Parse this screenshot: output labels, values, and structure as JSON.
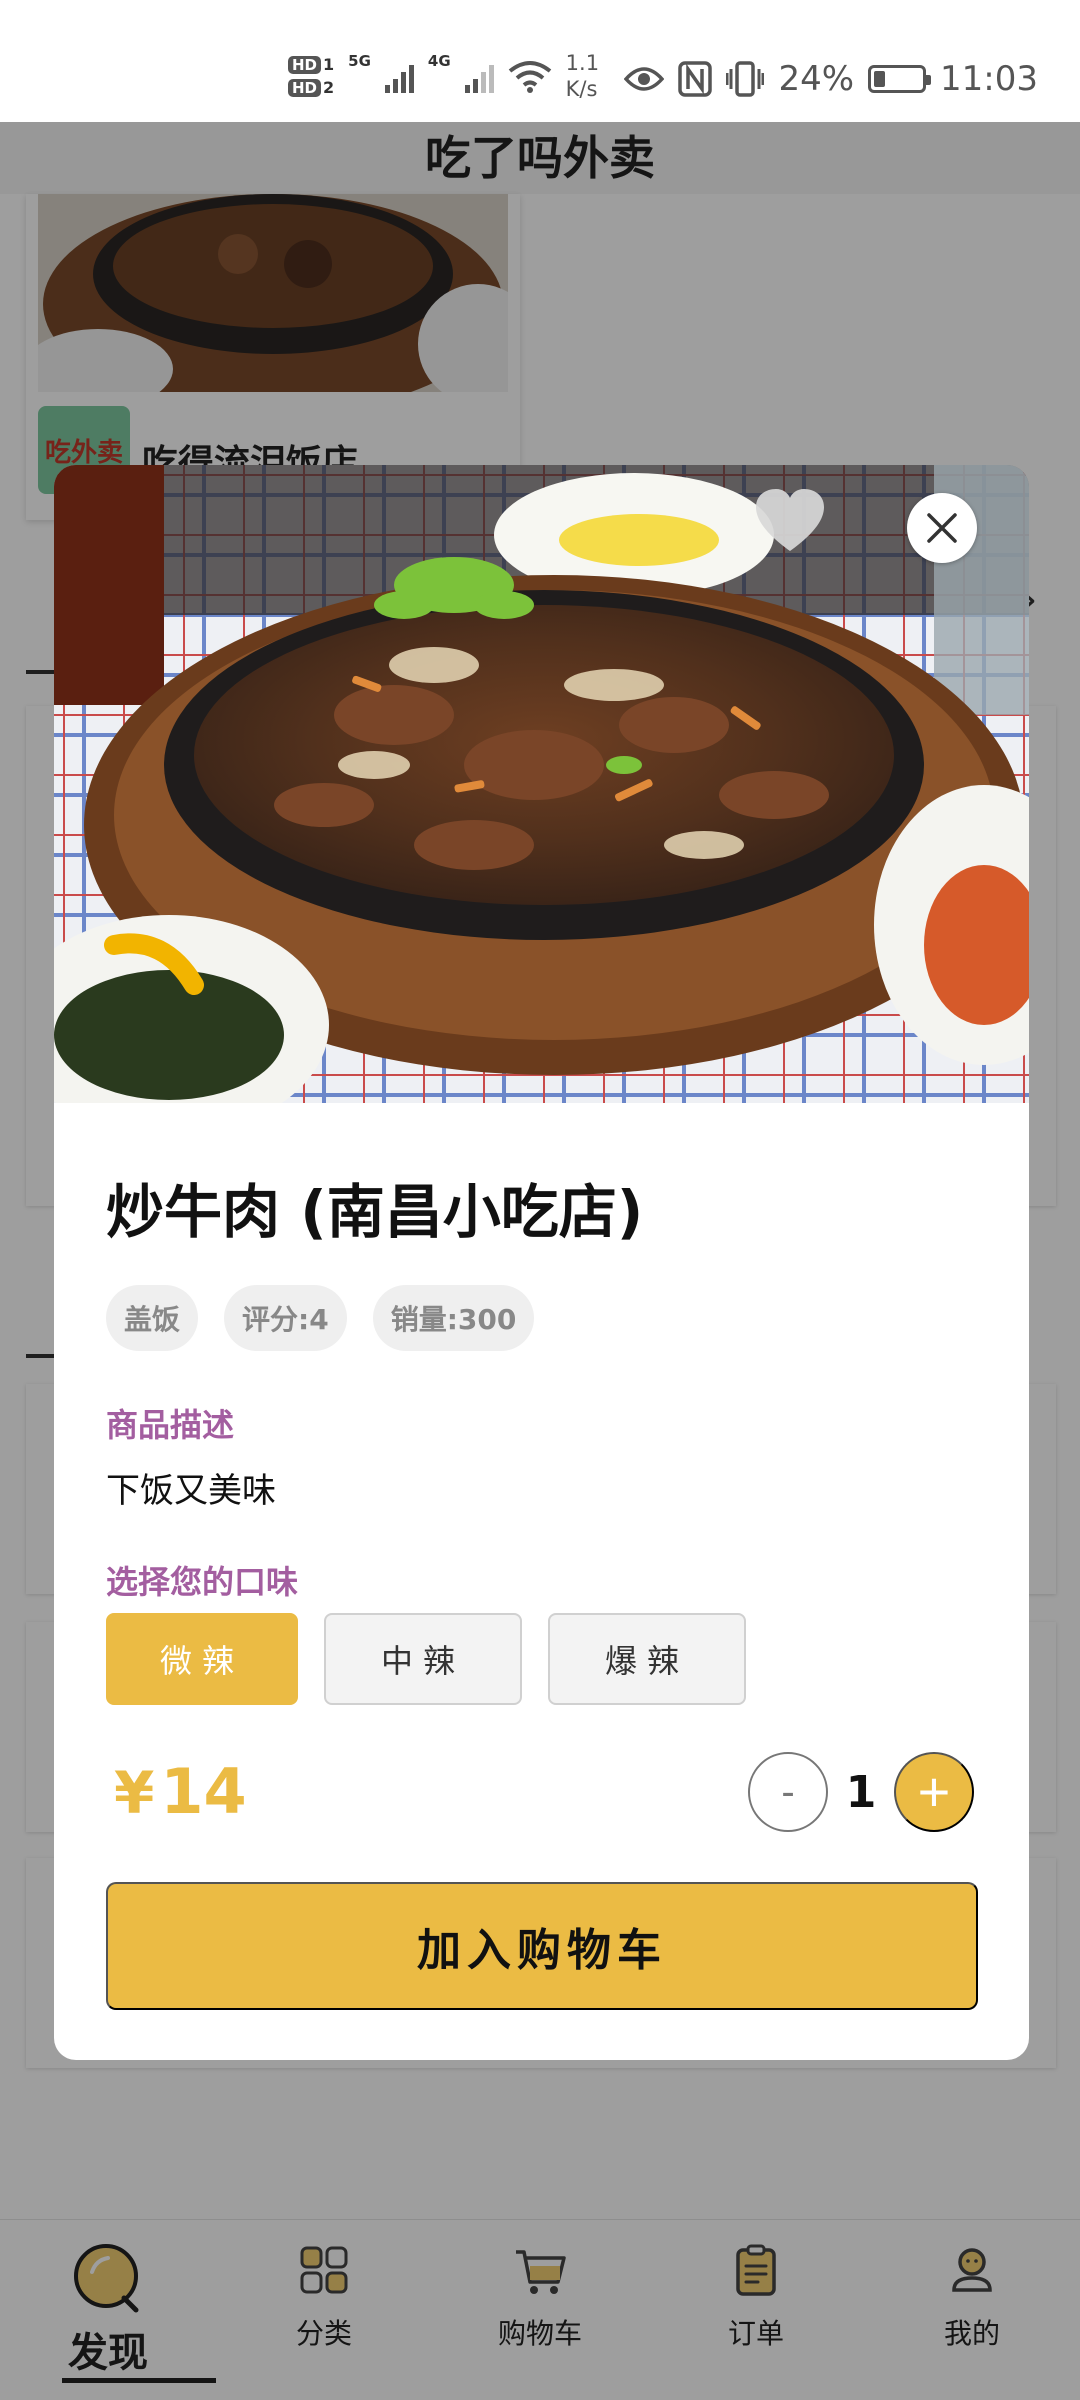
{
  "status_bar": {
    "hd1": "HD",
    "hd1_sub": "1",
    "hd2": "HD",
    "hd2_sub": "2",
    "net1": "5G",
    "net2": "4G",
    "speed_value": "1.1",
    "speed_unit": "K/s",
    "battery": "24%",
    "battery_level": 0.24,
    "time": "11:03"
  },
  "app": {
    "title": "吃了吗外卖"
  },
  "background": {
    "shop_name": "吃得流泪饭店",
    "shop_logo_text": "吃外卖"
  },
  "modal": {
    "dish_title": "炒牛肉 (南昌小吃店)",
    "tags": [
      "盖饭",
      "评分:4",
      "销量:300"
    ],
    "desc_label": "商品描述",
    "desc_text": "下饭又美味",
    "flavor_label": "选择您的口味",
    "flavors": [
      "微辣",
      "中辣",
      "爆辣"
    ],
    "selected_flavor": "微辣",
    "currency": "¥",
    "price": "14",
    "minus_label": "-",
    "quantity": "1",
    "plus_label": "+",
    "add_to_cart_label": "加入购物车",
    "favorite_icon": "heart-icon",
    "close_icon": "close-icon"
  },
  "tabbar": {
    "items": [
      {
        "label": "发现",
        "icon": "discover-icon",
        "active": true
      },
      {
        "label": "分类",
        "icon": "category-icon",
        "active": false
      },
      {
        "label": "购物车",
        "icon": "cart-icon",
        "active": false
      },
      {
        "label": "订单",
        "icon": "order-icon",
        "active": false
      },
      {
        "label": "我的",
        "icon": "profile-icon",
        "active": false
      }
    ]
  },
  "colors": {
    "accent": "#ebbb44",
    "section_label": "#a35ea0",
    "tag_bg": "#efefef"
  }
}
